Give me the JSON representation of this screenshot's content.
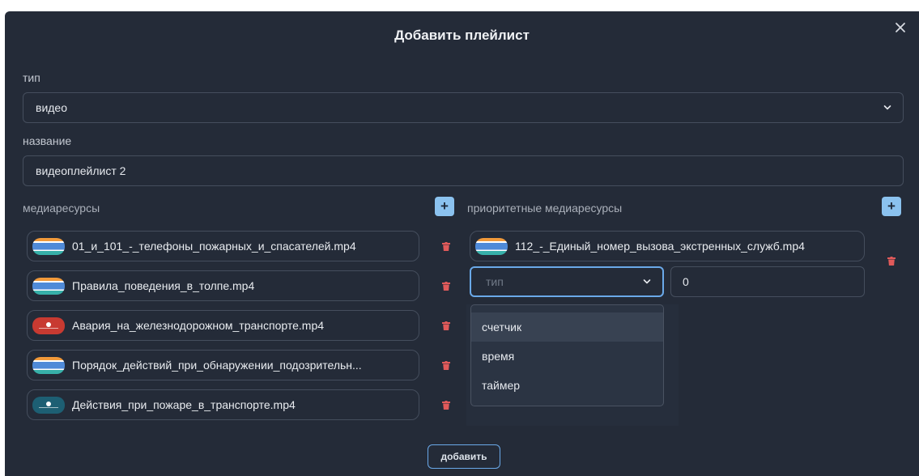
{
  "dialog": {
    "title": "Добавить плейлист",
    "add_button": "добавить"
  },
  "type_field": {
    "label": "тип",
    "value": "видео"
  },
  "name_field": {
    "label": "название",
    "value": "видеоплейлист 2"
  },
  "media": {
    "label": "медиаресурсы",
    "items": [
      {
        "file": "01_и_101_-_телефоны_пожарных_и_спасателей.mp4",
        "thumb": "stripe"
      },
      {
        "file": "Правила_поведения_в_толпе.mp4",
        "thumb": "stripe"
      },
      {
        "file": "Авария_на_железнодорожном_транспорте.mp4",
        "thumb": "red"
      },
      {
        "file": "Порядок_действий_при_обнаружении_подозрительн...",
        "thumb": "stripe"
      },
      {
        "file": "Действия_при_пожаре_в_транспорте.mp4",
        "thumb": "teal"
      }
    ]
  },
  "priority": {
    "label": "приоритетные медиаресурсы",
    "item": {
      "file": "112_-_Единый_номер_вызова_экстренных_служб.mp4",
      "thumb": "stripe"
    },
    "condition_placeholder": "тип",
    "count_value": "0",
    "options": [
      "счетчик",
      "время",
      "таймер"
    ],
    "highlighted_option": "счетчик"
  },
  "colors": {
    "modal_bg": "#242b38",
    "accent": "#6aa9e9",
    "plus_button": "#8bc2ef",
    "danger": "#e05a5a"
  },
  "icons": {
    "close": "close-icon",
    "chevron": "chevron-down-icon",
    "plus": "plus-icon",
    "delete": "trash-icon"
  }
}
